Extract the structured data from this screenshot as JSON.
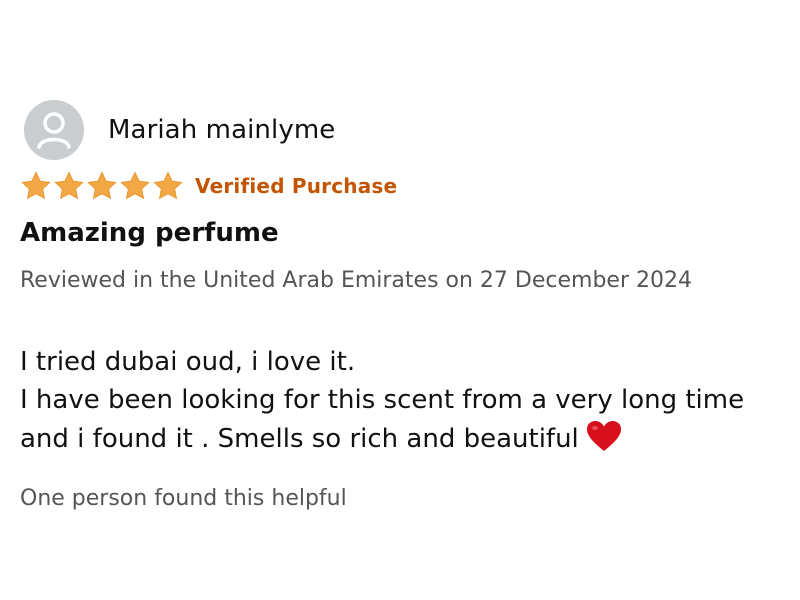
{
  "review": {
    "author_name": "Mariah mainlyme",
    "avatar_icon": "user-avatar-icon",
    "rating": 5,
    "rating_max": 5,
    "star_icon": "star-icon",
    "star_color": "#f3a847",
    "verified_label": "Verified Purchase",
    "verified_color": "#c45500",
    "title": "Amazing perfume",
    "meta": "Reviewed in the United Arab Emirates on 27 December 2024",
    "body_line1": "I tried dubai oud, i love it.",
    "body_line2": "I have been looking for this scent from a very long time and i found it . Smells so rich and beautiful",
    "heart_icon": "red-heart-emoji-icon",
    "heart_color": "#d8101e",
    "helpful_text": "One person found this helpful"
  }
}
